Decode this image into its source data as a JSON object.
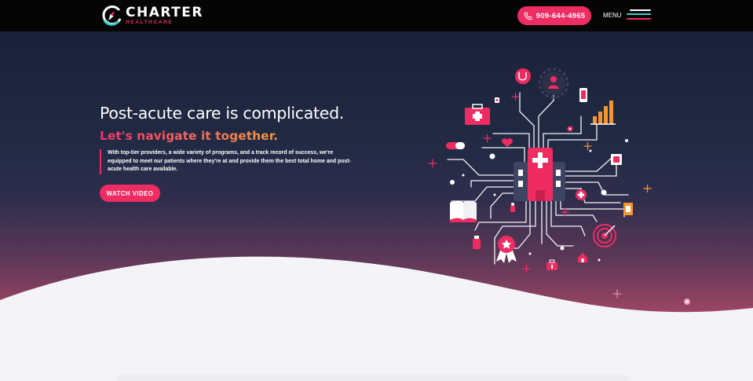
{
  "brand": {
    "name": "CHARTER",
    "subtitle": "HEALTHCARE"
  },
  "header": {
    "phone": "909-644-4965",
    "menu_label": "MENU"
  },
  "hero": {
    "headline": "Post-acute care is complicated.",
    "subheadline": "Let's navigate it together.",
    "description": "With top-tier providers, a wide variety of programs, and a track record of success, we're equipped to meet our patients where they're at and provide them the best total home and post-acute health care available.",
    "cta_label": "WATCH VIDEO"
  },
  "colors": {
    "accent": "#ee2c62",
    "teal": "#3ccdc8",
    "orange": "#f5952f",
    "topbar": "#050505",
    "hero_top": "#1b2138",
    "hero_bottom": "#c25070",
    "page_bg": "#f4f4f8"
  },
  "icons": [
    "phone-icon",
    "menu-icon",
    "stethoscope-icon",
    "doctor-icon",
    "first-aid-kit-icon",
    "smartphone-icon",
    "bar-chart-icon",
    "heart-icon",
    "pill-icon",
    "hospital-icon",
    "book-icon",
    "medal-icon",
    "target-icon",
    "medicine-bottle-icon",
    "frame-icon"
  ]
}
